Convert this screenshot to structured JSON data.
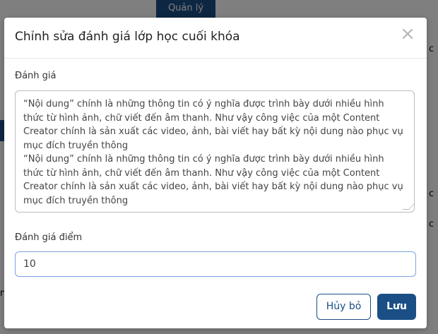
{
  "background": {
    "manage_button": "Quản lý",
    "right_fragment_1": "c",
    "right_fragment_2": "c",
    "right_fragment_3": "c",
    "left_fragment": "n"
  },
  "modal": {
    "title": "Chỉnh sửa đánh giá lớp học cuối khóa",
    "review_label": "Đánh giá",
    "review_paragraphs": [
      "“Nội dung” chính là những thông tin có ý nghĩa được trình bày dưới nhiều hình thức từ hình ảnh, chữ viết đến âm thanh. Như vậy công việc của một Content Creator chính là sản xuất các video, ảnh, bài viết hay bất kỳ nội dung nào phục vụ mục đích truyền thông",
      "“Nội dung” chính là những thông tin có ý nghĩa được trình bày dưới nhiều hình thức từ hình ảnh, chữ viết đến âm thanh. Như vậy công việc của một Content Creator chính là sản xuất các video, ảnh, bài viết hay bất kỳ nội dung nào phục vụ mục đích truyền thông"
    ],
    "score_label": "Đánh giá điểm",
    "score_value": "10",
    "cancel_label": "Hủy bỏ",
    "save_label": "Lưu"
  },
  "colors": {
    "primary": "#1a4f86",
    "overlay": "rgba(0,0,0,0.5)"
  }
}
